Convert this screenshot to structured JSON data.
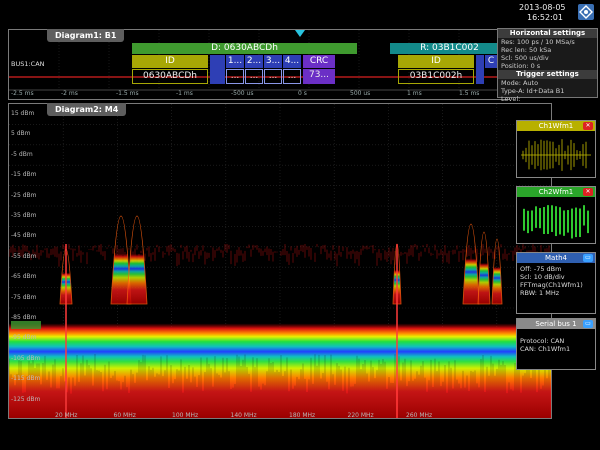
{
  "header": {
    "date": "2013-08-05",
    "time": "16:52:01"
  },
  "diagram1": {
    "title": "Diagram1: B1",
    "bus_label": "BUS1:CAN",
    "time_ticks": [
      "-2.5 ms",
      "-2 ms",
      "-1.5 ms",
      "-1 ms",
      "-500 us",
      "0 s",
      "500 us",
      "1 ms",
      "1.5 ms"
    ],
    "frame1": {
      "header": "D: 0630ABCDh",
      "id_label": "ID",
      "id_value": "0630ABCDh",
      "data_labels": [
        "1...",
        "2...",
        "3...",
        "4..."
      ],
      "data_values": [
        "...",
        "...",
        "...",
        "..."
      ],
      "crc_label": "CRC",
      "crc_value": "73..."
    },
    "frame2": {
      "header": "R: 03B1C002",
      "id_label": "ID",
      "id_value": "03B1C002h",
      "tail_label": "C",
      "tail_value": ""
    }
  },
  "horizontal_settings": {
    "title": "Horizontal settings",
    "lines": [
      "Res: 100 ps / 10 MSa/s",
      "Rec len: 50 kSa",
      "Scl: 500 us/div",
      "Position: 0 s"
    ],
    "trigger_title": "Trigger settings",
    "trigger_lines": [
      "Mode: Auto",
      "Type-A: Id+Data B1",
      "Level:"
    ]
  },
  "diagram2": {
    "title": "Diagram2: M4",
    "y_ticks": [
      "15 dBm",
      "5 dBm",
      "-5 dBm",
      "-15 dBm",
      "-25 dBm",
      "-35 dBm",
      "-45 dBm",
      "-55 dBm",
      "-65 dBm",
      "-75 dBm",
      "-85 dBm",
      "-95 dBm",
      "-105 dBm",
      "-115 dBm",
      "-125 dBm"
    ],
    "x_ticks": [
      "20 MHz",
      "60 MHz",
      "100 MHz",
      "140 MHz",
      "180 MHz",
      "220 MHz",
      "260 MHz"
    ]
  },
  "side_panels": {
    "ch1": {
      "title": "Ch1Wfm1"
    },
    "ch2": {
      "title": "Ch2Wfm1"
    },
    "math4": {
      "title": "Math4",
      "lines": [
        "Off: -75 dBm",
        "Scl: 10 dB/div",
        "FFTmag(Ch1Wfm1)",
        "RBW: 1 MHz"
      ]
    },
    "serial": {
      "title": "Serial bus 1",
      "lines": [
        "Protocol: CAN",
        "CAN: Ch1Wfm1"
      ]
    }
  },
  "colors": {
    "frame_green": "#3f9a2f",
    "frame_teal": "#138a8a",
    "field_olive": "#a7a705",
    "field_blue": "#2e3fb5",
    "crc_purple": "#6b2fc6",
    "red_line": "#d92020"
  }
}
